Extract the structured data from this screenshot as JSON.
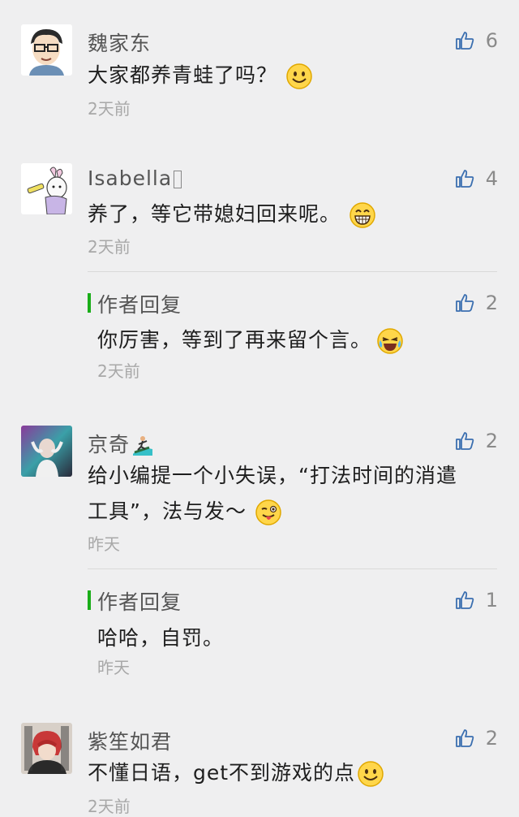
{
  "comments": [
    {
      "name": "魏家东",
      "text": "大家都养青蛙了吗？",
      "time": "2天前",
      "likes": "6",
      "emoji": "smile-emoji"
    },
    {
      "name": "Isabella",
      "text": "养了，等它带媳妇回来呢。",
      "time": "2天前",
      "likes": "4",
      "emoji": "grin-emoji",
      "reply": {
        "label": "作者回复",
        "text": "你厉害，等到了再来留个言。",
        "time": "2天前",
        "likes": "2",
        "emoji": "laugh-cry-emoji"
      }
    },
    {
      "name": "京奇",
      "text_line1": "给小编提一个小失误，“打法时间的消遣",
      "text_line2": "工具”，法与发～",
      "time": "昨天",
      "likes": "2",
      "emoji": "wink-tongue-emoji",
      "name_emoji": "surfer-emoji",
      "reply": {
        "label": "作者回复",
        "text": "哈哈，自罚。",
        "time": "昨天",
        "likes": "1"
      }
    },
    {
      "name": "紫笙如君",
      "text": "不懂日语，get不到游戏的点",
      "time": "2天前",
      "likes": "2",
      "emoji": "smile-emoji"
    }
  ],
  "colors": {
    "background": "#efeff0",
    "reply_accent": "#1aad19",
    "like_icon": "#3b6fb0"
  }
}
